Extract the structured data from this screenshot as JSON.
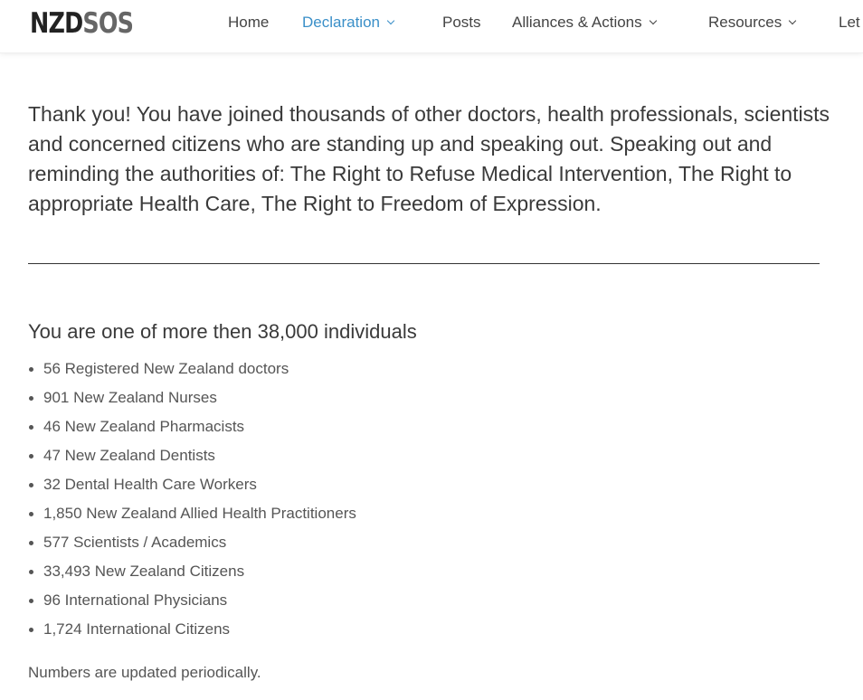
{
  "logo": {
    "part1": "NZD",
    "part2": "SOS"
  },
  "nav": {
    "items": [
      {
        "label": "Home",
        "dropdown": false,
        "active": false
      },
      {
        "label": "Declaration",
        "dropdown": true,
        "active": true
      },
      {
        "label": "Posts",
        "dropdown": false,
        "active": false
      },
      {
        "label": "Alliances & Actions",
        "dropdown": true,
        "active": false
      },
      {
        "label": "Resources",
        "dropdown": true,
        "active": false
      },
      {
        "label": "Let",
        "dropdown": false,
        "active": false
      }
    ],
    "active_color": "#3a8fc8"
  },
  "main": {
    "intro": "Thank you! You have joined thousands of other doctors, health professionals, scientists and concerned citizens who are standing up and speaking out. Speaking out and reminding the authorities of: The Right to Refuse Medical Intervention, The Right to appropriate Health Care, The Right to Freedom of Expression.",
    "heading": "You are one of more then 38,000 individuals",
    "stats": [
      "56 Registered New Zealand doctors",
      "901 New Zealand Nurses",
      "46 New Zealand Pharmacists",
      "47 New Zealand Dentists",
      "32 Dental Health Care Workers",
      "1,850 New Zealand Allied Health Practitioners",
      "577 Scientists / Academics",
      "33,493 New Zealand Citizens",
      "96 International Physicians",
      "1,724 International Citizens"
    ],
    "note": "Numbers are updated periodically."
  }
}
